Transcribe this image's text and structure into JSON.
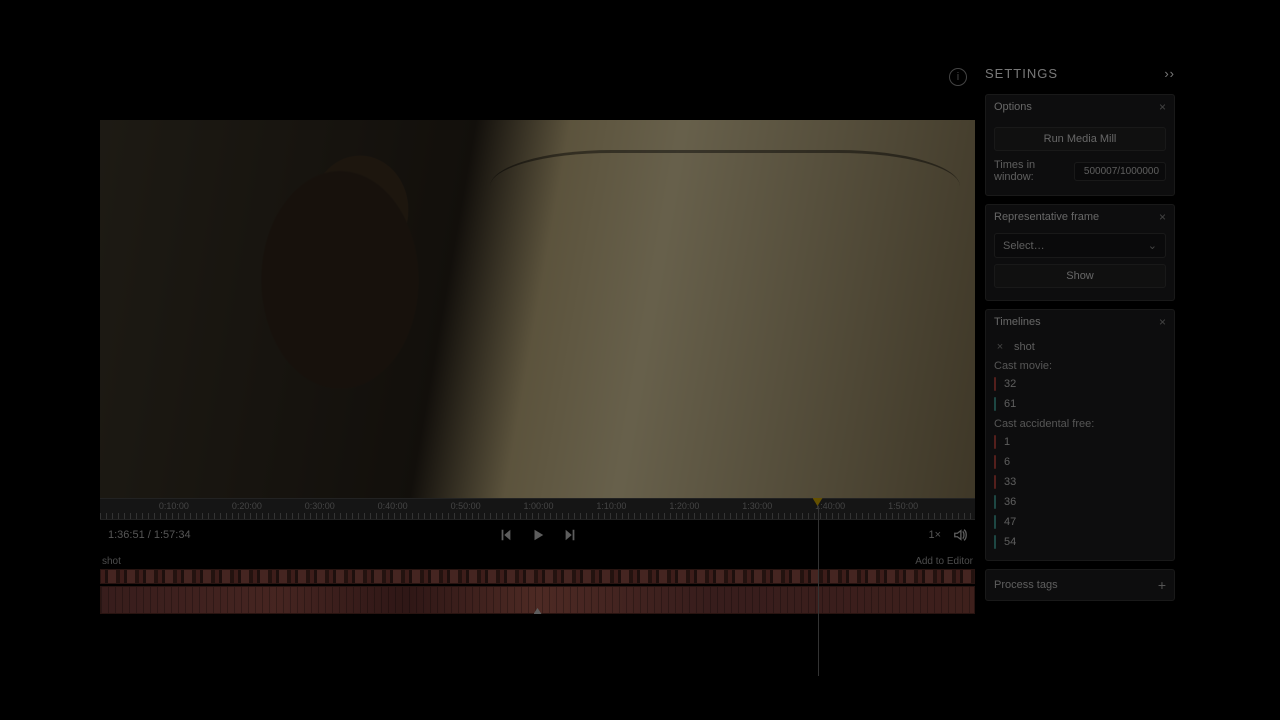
{
  "player": {
    "current_time": "1:36:51",
    "total_time": "1:57:34",
    "speed": "1×",
    "ruler_labels": [
      "0:10:00",
      "0:20:00",
      "0:30:00",
      "0:40:00",
      "0:50:00",
      "1:00:00",
      "1:10:00",
      "1:20:00",
      "1:30:00",
      "1:40:00",
      "1:50:00"
    ],
    "track_name": "shot",
    "track_action": "Add to Editor",
    "playhead_pct": 82
  },
  "settings": {
    "title": "SETTINGS",
    "options": {
      "title": "Options",
      "run_button": "Run Media Mill",
      "times_label": "Times in window:",
      "times_value": "500007/1000000"
    },
    "rep_frame": {
      "title": "Representative frame",
      "select_placeholder": "Select…",
      "show_button": "Show"
    },
    "timelines": {
      "title": "Timelines",
      "active": "shot",
      "group1_label": "Cast movie:",
      "group1": [
        {
          "color": "red",
          "num": "32"
        },
        {
          "color": "teal",
          "num": "61"
        }
      ],
      "group2_label": "Cast accidental free:",
      "group2": [
        {
          "color": "red",
          "num": "1"
        },
        {
          "color": "red",
          "num": "6"
        },
        {
          "color": "red",
          "num": "33"
        },
        {
          "color": "teal",
          "num": "36"
        },
        {
          "color": "teal",
          "num": "47"
        },
        {
          "color": "teal",
          "num": "54"
        }
      ]
    },
    "process_tags": {
      "title": "Process tags"
    }
  }
}
